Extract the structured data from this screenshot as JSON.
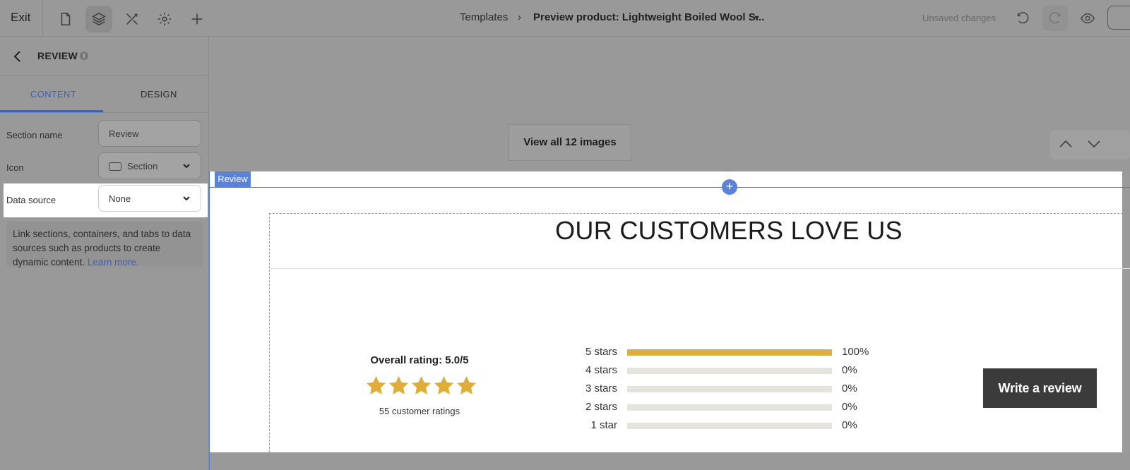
{
  "topbar": {
    "exit_label": "Exit",
    "breadcrumb_templates": "Templates",
    "breadcrumb_current": "Preview product: Lightweight Boiled Wool S...",
    "unsaved": "Unsaved changes",
    "icons": [
      "page-icon",
      "layers-icon",
      "tools-icon",
      "gear-icon",
      "plus-icon",
      "undo-icon",
      "redo-icon",
      "eye-icon",
      "desktop-icon"
    ]
  },
  "panel": {
    "title": "REVIEW",
    "tabs": [
      {
        "label": "CONTENT",
        "active": true
      },
      {
        "label": "DESIGN",
        "active": false
      }
    ],
    "fields": {
      "section_name_label": "Section name",
      "section_name_value": "Review",
      "icon_label": "Icon",
      "icon_value": "Section",
      "data_source_label": "Data source",
      "data_source_value": "None"
    },
    "help_text": "Link sections, containers, and tabs to data sources such as products to create dynamic content.",
    "help_link": "Learn more."
  },
  "canvas": {
    "view_all_button": "View all 12 images",
    "section_tag": "Review",
    "heading": "OUR CUSTOMERS LOVE US",
    "overall_rating": "Overall rating: 5.0/5",
    "star_count": 5,
    "ratings_count": "55 customer ratings",
    "star_color": "#e0ad38",
    "bars": [
      {
        "label": "5 stars",
        "percent": 100,
        "pct_label": "100%"
      },
      {
        "label": "4 stars",
        "percent": 0,
        "pct_label": "0%"
      },
      {
        "label": "3 stars",
        "percent": 0,
        "pct_label": "0%"
      },
      {
        "label": "2 stars",
        "percent": 0,
        "pct_label": "0%"
      },
      {
        "label": "1 star",
        "percent": 0,
        "pct_label": "0%"
      }
    ],
    "write_review_button": "Write a review"
  }
}
